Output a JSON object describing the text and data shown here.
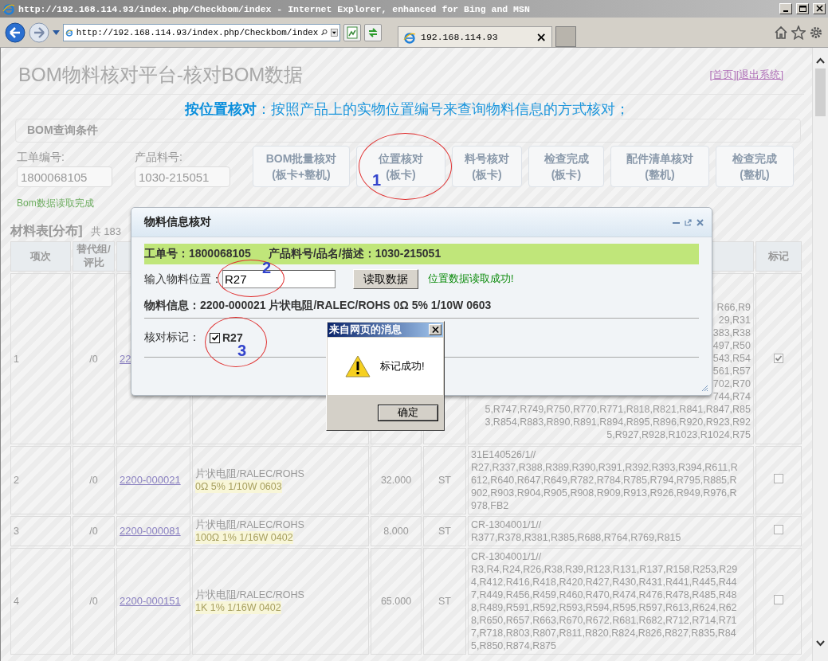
{
  "window": {
    "title": "http://192.168.114.93/index.php/Checkbom/index - Internet Explorer, enhanced for Bing and MSN"
  },
  "toolbar": {
    "address": "http://192.168.114.93/index.php/Checkbom/index",
    "tab_title": "192.168.114.93",
    "tab_close": "×"
  },
  "header": {
    "title": "BOM物料核对平台-核对BOM数据",
    "links": [
      "[首页]",
      "[退出系统]"
    ]
  },
  "mode_banner": "**按位置核对**：按照产品上的实物位置编号来查询物料信息的方式核对；",
  "query_panel": {
    "title": "BOM查询条件",
    "fields": [
      {
        "label": "工单编号:",
        "value": "1800068105"
      },
      {
        "label": "产品料号:",
        "value": "1030-215051"
      }
    ],
    "buttons": [
      {
        "lines": [
          "BOM批量核对",
          "(板卡+整机)"
        ]
      },
      {
        "lines": [
          "位置核对",
          "(板卡)"
        ]
      },
      {
        "lines": [
          "料号核对",
          "(板卡)"
        ]
      },
      {
        "lines": [
          "检查完成",
          "(板卡)"
        ]
      },
      {
        "lines": [
          "配件清单核对",
          "(整机)"
        ]
      },
      {
        "lines": [
          "检查完成",
          "(整机)"
        ]
      }
    ],
    "status": "Bom数据读取完成"
  },
  "table": {
    "title": "材料表[分布]",
    "count": "共 183",
    "columns": {
      "column_1": "项次",
      "column_2": "替代组/评比",
      "column_8": "标记"
    },
    "rows": [
      {
        "kind": "covered",
        "index": "1",
        "ratio": "/0",
        "part": "22",
        "location_lines": [
          "R66,R9",
          "29,R31",
          "383,R38",
          "497,R50",
          "543,R54",
          "561,R57",
          "702,R70",
          "744,R74",
          "5,R747,R749,R750,R770,R771,R818,R821,R841,R847,R85",
          "3,R854,R883,R890,R891,R894,R895,R896,R920,R923,R92",
          "5,R927,R928,R1023,R1024,R75"
        ],
        "marked": true
      },
      {
        "kind": "full",
        "index": "2",
        "ratio": "/0",
        "part": "2200-000021",
        "desc": "片状电阻/RALEC/ROHS",
        "spec": "0Ω 5% 1/10W 0603",
        "qty": "32.000",
        "unit": "ST",
        "location_lines": [
          "31E140526/1//",
          "R27,R337,R388,R389,R390,R391,R392,R393,R394,R611,R",
          "612,R640,R647,R649,R782,R784,R785,R794,R795,R885,R",
          "902,R903,R904,R905,R908,R909,R913,R926,R949,R976,R",
          "978,FB2"
        ],
        "marked": false
      },
      {
        "kind": "full",
        "index": "3",
        "ratio": "/0",
        "part": "2200-000081",
        "desc": "片状电阻/RALEC/ROHS",
        "spec": "100Ω 1% 1/16W 0402",
        "qty": "8.000",
        "unit": "ST",
        "location_lines": [
          "CR-1304001/1//",
          "R377,R378,R381,R385,R688,R764,R769,R815"
        ],
        "marked": false
      },
      {
        "kind": "full",
        "index": "4",
        "ratio": "/0",
        "part": "2200-000151",
        "desc": "片状电阻/RALEC/ROHS",
        "spec": "1K 1% 1/16W 0402",
        "qty": "65.000",
        "unit": "ST",
        "location_lines": [
          "CR-1304001/1//",
          "R3,R4,R24,R26,R38,R39,R123,R131,R137,R158,R253,R29",
          "4,R412,R416,R418,R420,R427,R430,R431,R441,R445,R44",
          "7,R449,R456,R459,R460,R470,R474,R476,R478,R485,R48",
          "8,R489,R591,R592,R593,R594,R595,R597,R613,R624,R62",
          "8,R650,R657,R663,R670,R672,R681,R682,R712,R714,R71",
          "7,R718,R803,R807,R811,R820,R824,R826,R827,R835,R84",
          "5,R850,R874,R875"
        ],
        "marked": false
      }
    ]
  },
  "dialog": {
    "title": "物料信息核对",
    "order": "工单号：1800068105",
    "product": "产品料号/品名/描述：1030-215051",
    "position_label": "输入物料位置：",
    "position_value": "R27",
    "read_button": "读取数据",
    "read_status": "位置数据读取成功!",
    "material_info": "物料信息：2200-000021  片状电阻/RALEC/ROHS  0Ω 5% 1/10W 0603",
    "mark_label": "核对标记：",
    "mark_item": {
      "label": "R27",
      "checked": true
    }
  },
  "message_box": {
    "title": "来自网页的消息",
    "message": "标记成功!",
    "ok_button": "确定"
  },
  "annotations": [
    {
      "label": "1"
    },
    {
      "label": "2"
    },
    {
      "label": "3"
    }
  ]
}
